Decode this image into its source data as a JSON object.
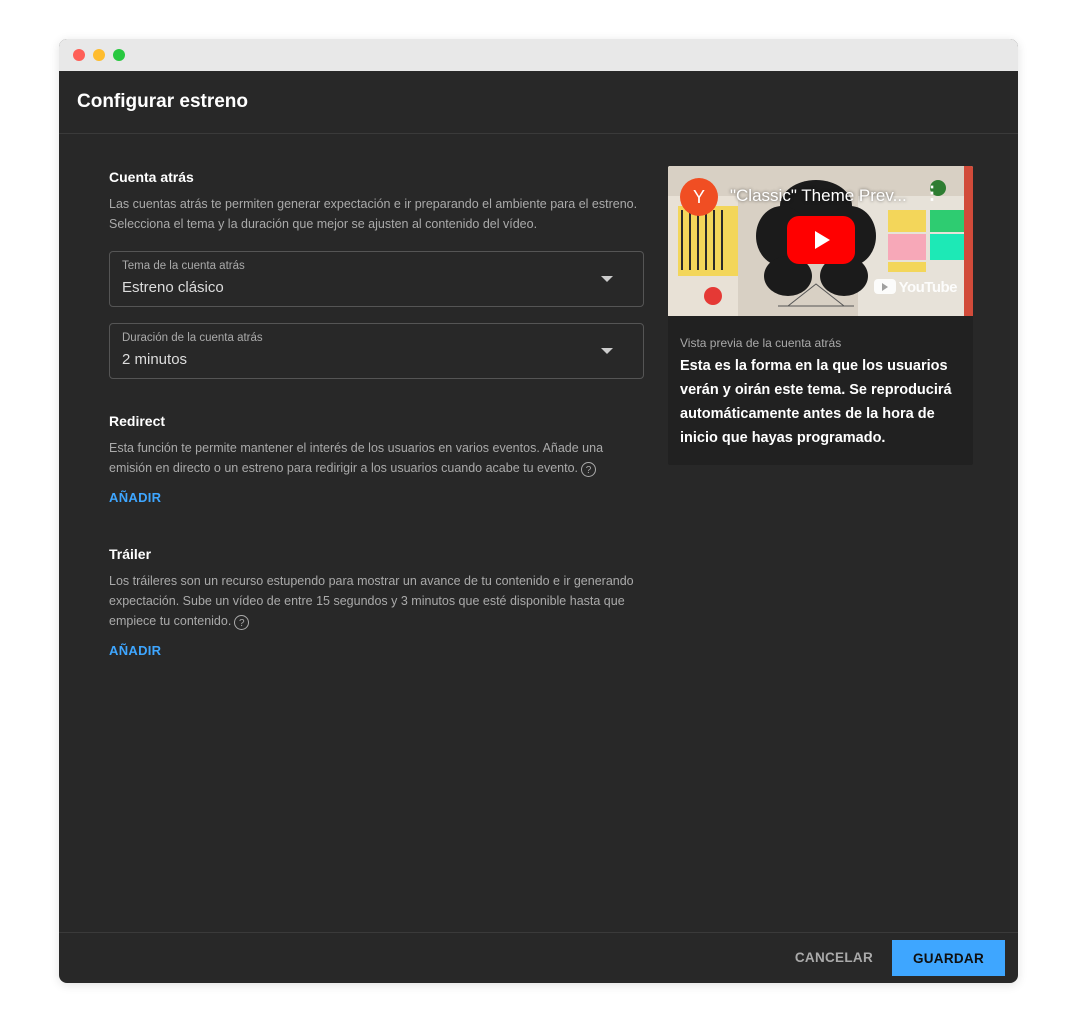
{
  "dialog": {
    "title": "Configurar estreno"
  },
  "countdown": {
    "title": "Cuenta atrás",
    "description": "Las cuentas atrás te permiten generar expectación e ir preparando el ambiente para el estreno. Selecciona el tema y la duración que mejor se ajusten al contenido del vídeo.",
    "theme_select": {
      "label": "Tema de la cuenta atrás",
      "value": "Estreno clásico"
    },
    "duration_select": {
      "label": "Duración de la cuenta atrás",
      "value": "2 minutos"
    }
  },
  "redirect": {
    "title": "Redirect",
    "description": "Esta función te permite mantener el interés de los usuarios en varios eventos. Añade una emisión en directo o un estreno para redirigir a los usuarios cuando acabe tu evento.",
    "help_icon": "?",
    "add_label": "AÑADIR"
  },
  "trailer": {
    "title": "Tráiler",
    "description": "Los tráileres son un recurso estupendo para mostrar un avance de tu contenido e ir generando expectación. Sube un vídeo de entre 15 segundos y 3 minutos que esté disponible hasta que empiece tu contenido.",
    "help_icon": "?",
    "add_label": "AÑADIR"
  },
  "preview": {
    "video": {
      "avatar_letter": "Y",
      "title": "\"Classic\" Theme Prev...",
      "watermark": "YouTube",
      "play_icon": "play-icon",
      "menu_icon": "kebab-icon"
    },
    "label": "Vista previa de la cuenta atrás",
    "text": "Esta es la forma en la que los usuarios verán y oirán este tema. Se reproducirá automáticamente antes de la hora de inicio que hayas programado."
  },
  "footer": {
    "cancel_label": "CANCELAR",
    "save_label": "GUARDAR"
  },
  "colors": {
    "background": "#282828",
    "accent": "#3ea6ff",
    "avatar": "#f04e23",
    "play": "#ff0000"
  }
}
